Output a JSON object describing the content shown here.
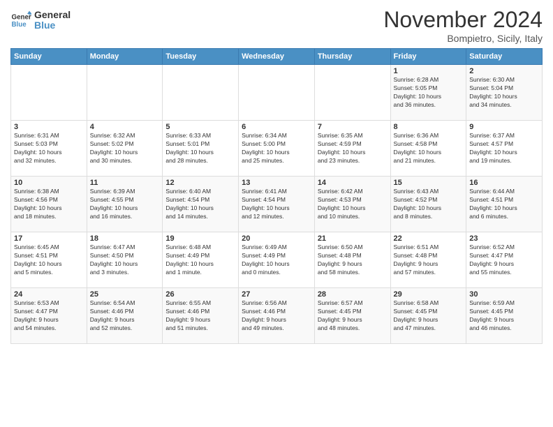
{
  "logo": {
    "text_general": "General",
    "text_blue": "Blue"
  },
  "header": {
    "month": "November 2024",
    "location": "Bompietro, Sicily, Italy"
  },
  "weekdays": [
    "Sunday",
    "Monday",
    "Tuesday",
    "Wednesday",
    "Thursday",
    "Friday",
    "Saturday"
  ],
  "weeks": [
    [
      {
        "day": "",
        "info": ""
      },
      {
        "day": "",
        "info": ""
      },
      {
        "day": "",
        "info": ""
      },
      {
        "day": "",
        "info": ""
      },
      {
        "day": "",
        "info": ""
      },
      {
        "day": "1",
        "info": "Sunrise: 6:28 AM\nSunset: 5:05 PM\nDaylight: 10 hours\nand 36 minutes."
      },
      {
        "day": "2",
        "info": "Sunrise: 6:30 AM\nSunset: 5:04 PM\nDaylight: 10 hours\nand 34 minutes."
      }
    ],
    [
      {
        "day": "3",
        "info": "Sunrise: 6:31 AM\nSunset: 5:03 PM\nDaylight: 10 hours\nand 32 minutes."
      },
      {
        "day": "4",
        "info": "Sunrise: 6:32 AM\nSunset: 5:02 PM\nDaylight: 10 hours\nand 30 minutes."
      },
      {
        "day": "5",
        "info": "Sunrise: 6:33 AM\nSunset: 5:01 PM\nDaylight: 10 hours\nand 28 minutes."
      },
      {
        "day": "6",
        "info": "Sunrise: 6:34 AM\nSunset: 5:00 PM\nDaylight: 10 hours\nand 25 minutes."
      },
      {
        "day": "7",
        "info": "Sunrise: 6:35 AM\nSunset: 4:59 PM\nDaylight: 10 hours\nand 23 minutes."
      },
      {
        "day": "8",
        "info": "Sunrise: 6:36 AM\nSunset: 4:58 PM\nDaylight: 10 hours\nand 21 minutes."
      },
      {
        "day": "9",
        "info": "Sunrise: 6:37 AM\nSunset: 4:57 PM\nDaylight: 10 hours\nand 19 minutes."
      }
    ],
    [
      {
        "day": "10",
        "info": "Sunrise: 6:38 AM\nSunset: 4:56 PM\nDaylight: 10 hours\nand 18 minutes."
      },
      {
        "day": "11",
        "info": "Sunrise: 6:39 AM\nSunset: 4:55 PM\nDaylight: 10 hours\nand 16 minutes."
      },
      {
        "day": "12",
        "info": "Sunrise: 6:40 AM\nSunset: 4:54 PM\nDaylight: 10 hours\nand 14 minutes."
      },
      {
        "day": "13",
        "info": "Sunrise: 6:41 AM\nSunset: 4:54 PM\nDaylight: 10 hours\nand 12 minutes."
      },
      {
        "day": "14",
        "info": "Sunrise: 6:42 AM\nSunset: 4:53 PM\nDaylight: 10 hours\nand 10 minutes."
      },
      {
        "day": "15",
        "info": "Sunrise: 6:43 AM\nSunset: 4:52 PM\nDaylight: 10 hours\nand 8 minutes."
      },
      {
        "day": "16",
        "info": "Sunrise: 6:44 AM\nSunset: 4:51 PM\nDaylight: 10 hours\nand 6 minutes."
      }
    ],
    [
      {
        "day": "17",
        "info": "Sunrise: 6:45 AM\nSunset: 4:51 PM\nDaylight: 10 hours\nand 5 minutes."
      },
      {
        "day": "18",
        "info": "Sunrise: 6:47 AM\nSunset: 4:50 PM\nDaylight: 10 hours\nand 3 minutes."
      },
      {
        "day": "19",
        "info": "Sunrise: 6:48 AM\nSunset: 4:49 PM\nDaylight: 10 hours\nand 1 minute."
      },
      {
        "day": "20",
        "info": "Sunrise: 6:49 AM\nSunset: 4:49 PM\nDaylight: 10 hours\nand 0 minutes."
      },
      {
        "day": "21",
        "info": "Sunrise: 6:50 AM\nSunset: 4:48 PM\nDaylight: 9 hours\nand 58 minutes."
      },
      {
        "day": "22",
        "info": "Sunrise: 6:51 AM\nSunset: 4:48 PM\nDaylight: 9 hours\nand 57 minutes."
      },
      {
        "day": "23",
        "info": "Sunrise: 6:52 AM\nSunset: 4:47 PM\nDaylight: 9 hours\nand 55 minutes."
      }
    ],
    [
      {
        "day": "24",
        "info": "Sunrise: 6:53 AM\nSunset: 4:47 PM\nDaylight: 9 hours\nand 54 minutes."
      },
      {
        "day": "25",
        "info": "Sunrise: 6:54 AM\nSunset: 4:46 PM\nDaylight: 9 hours\nand 52 minutes."
      },
      {
        "day": "26",
        "info": "Sunrise: 6:55 AM\nSunset: 4:46 PM\nDaylight: 9 hours\nand 51 minutes."
      },
      {
        "day": "27",
        "info": "Sunrise: 6:56 AM\nSunset: 4:46 PM\nDaylight: 9 hours\nand 49 minutes."
      },
      {
        "day": "28",
        "info": "Sunrise: 6:57 AM\nSunset: 4:45 PM\nDaylight: 9 hours\nand 48 minutes."
      },
      {
        "day": "29",
        "info": "Sunrise: 6:58 AM\nSunset: 4:45 PM\nDaylight: 9 hours\nand 47 minutes."
      },
      {
        "day": "30",
        "info": "Sunrise: 6:59 AM\nSunset: 4:45 PM\nDaylight: 9 hours\nand 46 minutes."
      }
    ]
  ]
}
